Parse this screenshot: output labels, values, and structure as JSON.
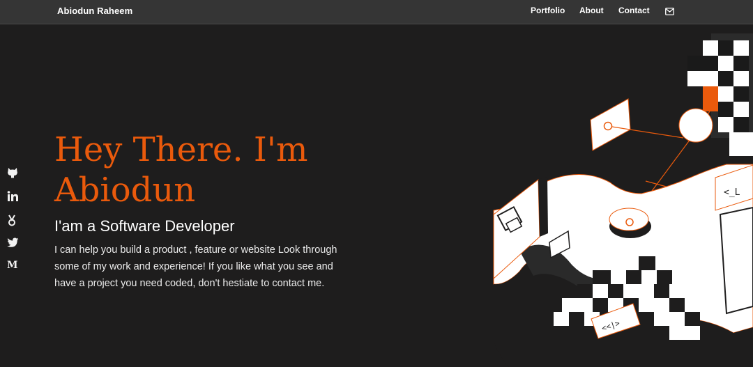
{
  "nav": {
    "brand": "Abiodun Raheem",
    "links": [
      {
        "label": "Portfolio"
      },
      {
        "label": "About"
      },
      {
        "label": "Contact"
      }
    ],
    "mail_icon": "mail-icon"
  },
  "socials": [
    {
      "icon": "github-icon"
    },
    {
      "icon": "linkedin-icon"
    },
    {
      "icon": "dev-badge-icon"
    },
    {
      "icon": "twitter-icon"
    },
    {
      "icon": "medium-icon",
      "glyph": "M"
    }
  ],
  "hero": {
    "title": "Hey There. I'm Abiodun",
    "subtitle": "I'am a Software Developer",
    "description": "I can help you build a product , feature or website Look through some of my work and experience! If you like what you see and have a project you need coded, don't hestiate to contact me."
  },
  "illustration": {
    "code_tag_top": "<_L",
    "code_tag_bottom": "<<|>"
  },
  "colors": {
    "accent": "#ea5a0c",
    "background": "#1e1d1d",
    "navbar": "#353535"
  }
}
